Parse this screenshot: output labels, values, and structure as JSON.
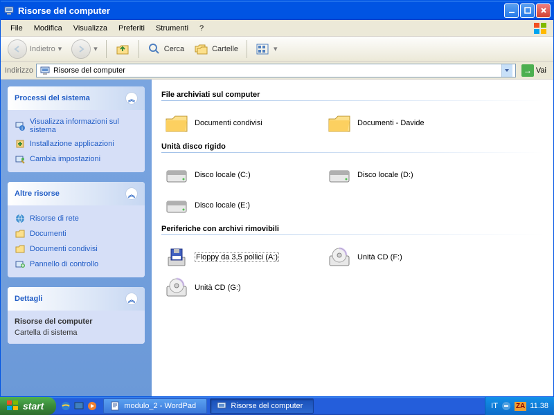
{
  "window": {
    "title": "Risorse del computer"
  },
  "menubar": {
    "items": [
      "File",
      "Modifica",
      "Visualizza",
      "Preferiti",
      "Strumenti",
      "?"
    ]
  },
  "toolbar": {
    "back": "Indietro",
    "search": "Cerca",
    "folders": "Cartelle"
  },
  "address": {
    "label": "Indirizzo",
    "value": "Risorse del computer",
    "go": "Vai"
  },
  "sidebar": {
    "panels": [
      {
        "title": "Processi del sistema",
        "links": [
          "Visualizza informazioni sul sistema",
          "Installazione applicazioni",
          "Cambia impostazioni"
        ]
      },
      {
        "title": "Altre risorse",
        "links": [
          "Risorse di rete",
          "Documenti",
          "Documenti condivisi",
          "Pannello di controllo"
        ]
      },
      {
        "title": "Dettagli",
        "text_bold": "Risorse del computer",
        "text": "Cartella di sistema"
      }
    ]
  },
  "main": {
    "sections": [
      {
        "title": "File archiviati sul computer",
        "items": [
          {
            "icon": "folder",
            "label": "Documenti condivisi"
          },
          {
            "icon": "folder",
            "label": "Documenti - Davide"
          }
        ]
      },
      {
        "title": "Unità disco rigido",
        "items": [
          {
            "icon": "hdd",
            "label": "Disco locale (C:)"
          },
          {
            "icon": "hdd",
            "label": "Disco locale (D:)"
          },
          {
            "icon": "hdd",
            "label": "Disco locale (E:)"
          }
        ]
      },
      {
        "title": "Periferiche con archivi rimovibili",
        "items": [
          {
            "icon": "floppy",
            "label": "Floppy da 3,5 pollici (A:)",
            "selected": true
          },
          {
            "icon": "cd",
            "label": "Unità CD (F:)"
          },
          {
            "icon": "cd",
            "label": "Unità CD (G:)"
          }
        ]
      }
    ]
  },
  "taskbar": {
    "start": "start",
    "tasks": [
      {
        "label": "modulo_2 - WordPad",
        "active": false
      },
      {
        "label": "Risorse del computer",
        "active": true
      }
    ],
    "lang": "IT",
    "clock": "11.38"
  }
}
